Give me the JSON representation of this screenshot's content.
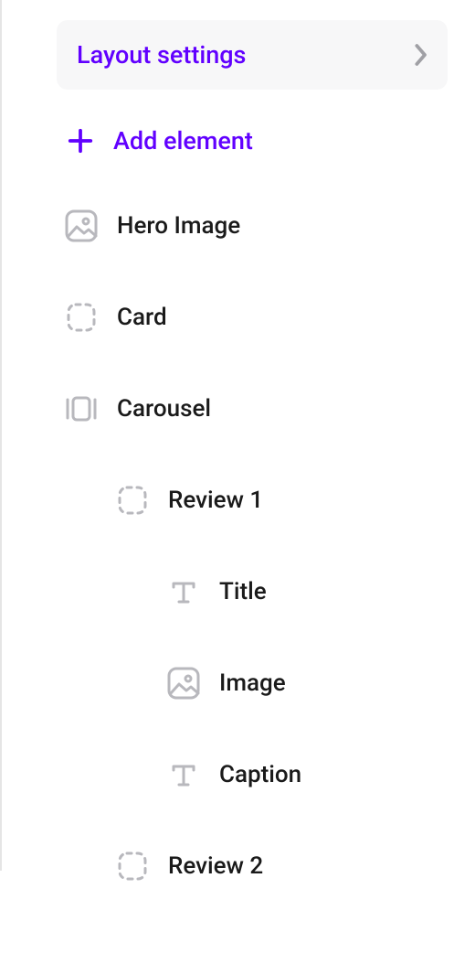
{
  "header": {
    "title": "Layout settings"
  },
  "add_element": {
    "label": "Add element"
  },
  "tree": {
    "items": [
      {
        "label": "Hero Image",
        "icon": "image",
        "level": 0
      },
      {
        "label": "Card",
        "icon": "placeholder",
        "level": 0
      },
      {
        "label": "Carousel",
        "icon": "carousel",
        "level": 0
      },
      {
        "label": "Review 1",
        "icon": "placeholder",
        "level": 1
      },
      {
        "label": "Title",
        "icon": "text",
        "level": 2
      },
      {
        "label": "Image",
        "icon": "image",
        "level": 2
      },
      {
        "label": "Caption",
        "icon": "text",
        "level": 2
      },
      {
        "label": "Review 2",
        "icon": "placeholder",
        "level": 1
      }
    ]
  }
}
